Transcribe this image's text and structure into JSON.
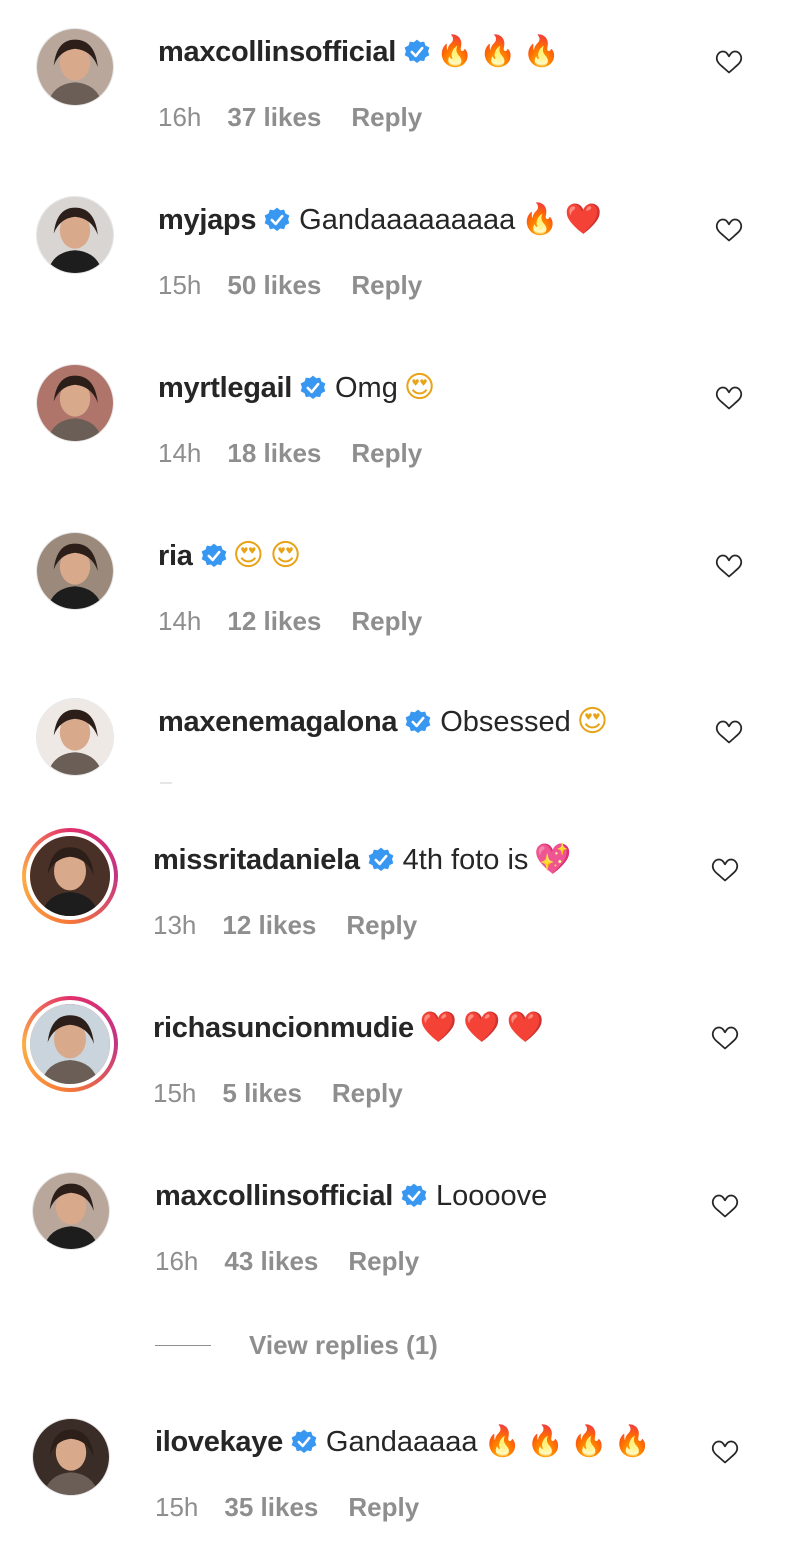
{
  "comments": [
    {
      "username": "maxcollinsofficial",
      "verified": true,
      "text": "",
      "emoji": [
        "🔥",
        "🔥",
        "🔥"
      ],
      "emoji_kind": "fire",
      "time": "16h",
      "likes": "37 likes",
      "reply": "Reply",
      "ring": false,
      "avatar_color": "#b9a79c"
    },
    {
      "username": "myjaps",
      "verified": true,
      "text": "Gandaaaaaaaaa",
      "emoji": [
        "🔥",
        "❤️"
      ],
      "emoji_kind": "mixed",
      "time": "15h",
      "likes": "50 likes",
      "reply": "Reply",
      "ring": false,
      "avatar_color": "#d9d5d2"
    },
    {
      "username": "myrtlegail",
      "verified": true,
      "text": "Omg",
      "emoji": [
        "😍"
      ],
      "emoji_kind": "love",
      "time": "14h",
      "likes": "18 likes",
      "reply": "Reply",
      "ring": false,
      "avatar_color": "#b0756a"
    },
    {
      "username": "ria",
      "verified": true,
      "text": "",
      "emoji": [
        "😍",
        "😍"
      ],
      "emoji_kind": "love",
      "time": "14h",
      "likes": "12 likes",
      "reply": "Reply",
      "ring": false,
      "avatar_color": "#9b8a7c"
    },
    {
      "username": "maxenemagalona",
      "verified": true,
      "text": "Obsessed",
      "emoji": [
        "😍"
      ],
      "emoji_kind": "love",
      "time": "",
      "likes": "",
      "reply": "",
      "ring": false,
      "avatar_color": "#efe9e6"
    },
    {
      "username": "missritadaniela",
      "verified": true,
      "text": "4th foto is",
      "emoji": [
        "💖"
      ],
      "emoji_kind": "heart",
      "time": "13h",
      "likes": "12 likes",
      "reply": "Reply",
      "ring": true,
      "avatar_color": "#4a3128"
    },
    {
      "username": "richasuncionmudie",
      "verified": false,
      "text": "",
      "emoji": [
        "❤️",
        "❤️",
        "❤️"
      ],
      "emoji_kind": "heart",
      "time": "15h",
      "likes": "5 likes",
      "reply": "Reply",
      "ring": true,
      "avatar_color": "#c9d4dc"
    },
    {
      "username": "maxcollinsofficial",
      "verified": true,
      "text": "Loooove",
      "emoji": [],
      "emoji_kind": "none",
      "time": "16h",
      "likes": "43 likes",
      "reply": "Reply",
      "ring": false,
      "avatar_color": "#b9a79c"
    },
    {
      "username": "ilovekaye",
      "verified": true,
      "text": "Gandaaaaa",
      "emoji": [
        "🔥",
        "🔥",
        "🔥",
        "🔥"
      ],
      "emoji_kind": "fire",
      "time": "15h",
      "likes": "35 likes",
      "reply": "Reply",
      "ring": false,
      "avatar_color": "#3a2c26"
    }
  ],
  "view_replies": "View replies (1)",
  "icons": {
    "verified": "verified-badge-icon",
    "like": "heart-outline-icon"
  },
  "colors": {
    "verified": "#3897f0",
    "meta": "#8e8e8e",
    "text": "#262626"
  }
}
